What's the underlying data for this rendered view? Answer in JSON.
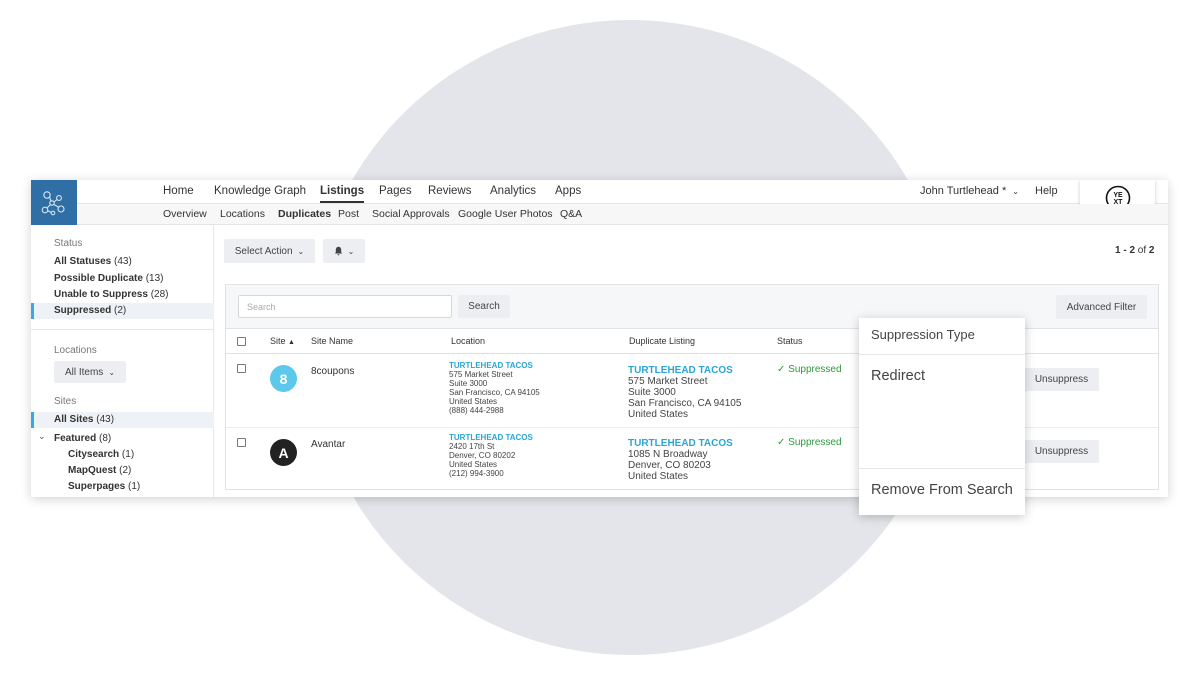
{
  "nav": {
    "primary": [
      "Home",
      "Knowledge Graph",
      "Listings",
      "Pages",
      "Reviews",
      "Analytics",
      "Apps"
    ],
    "secondary": [
      "Overview",
      "Locations",
      "Duplicates",
      "Post",
      "Social Approvals",
      "Google User Photos",
      "Q&A"
    ],
    "user": "John Turtlehead *",
    "help": "Help"
  },
  "sidebar": {
    "status_label": "Status",
    "statuses": [
      {
        "label": "All Statuses",
        "count": "(43)"
      },
      {
        "label": "Possible Duplicate",
        "count": "(13)"
      },
      {
        "label": "Unable to Suppress",
        "count": "(28)"
      },
      {
        "label": "Suppressed",
        "count": "(2)"
      }
    ],
    "locations_label": "Locations",
    "locations_value": "All Items",
    "sites_label": "Sites",
    "sites": [
      {
        "label": "All Sites",
        "count": "(43)"
      },
      {
        "label": "Featured",
        "count": "(8)"
      },
      {
        "label": "Citysearch",
        "count": "(1)"
      },
      {
        "label": "MapQuest",
        "count": "(2)"
      },
      {
        "label": "Superpages",
        "count": "(1)"
      }
    ]
  },
  "toolbar": {
    "select_action": "Select Action",
    "pagination_range": "1 - 2",
    "pagination_of": "of",
    "pagination_total": "2"
  },
  "filter": {
    "search_placeholder": "Search",
    "search_button": "Search",
    "advanced_filter": "Advanced Filter"
  },
  "table": {
    "headers": {
      "site": "Site",
      "site_name": "Site Name",
      "location": "Location",
      "duplicate": "Duplicate Listing",
      "status": "Status"
    },
    "rows": [
      {
        "site_name": "8coupons",
        "avatar_letter": "8",
        "avatar_color": "#5bc8ec",
        "location": [
          "TURTLEHEAD TACOS",
          "575 Market Street",
          "Suite 3000",
          "San Francisco, CA 94105",
          "United States",
          "(888) 444-2988"
        ],
        "duplicate": [
          "TURTLEHEAD TACOS",
          "575 Market Street",
          "Suite 3000",
          "San Francisco, CA 94105",
          "United States"
        ],
        "status": "Suppressed",
        "action": "Unsuppress"
      },
      {
        "site_name": "Avantar",
        "avatar_letter": "A",
        "avatar_color": "#222222",
        "location": [
          "TURTLEHEAD TACOS",
          "2420 17th St",
          "Denver, CO 80202",
          "United States",
          "(212) 994-3900"
        ],
        "duplicate": [
          "TURTLEHEAD TACOS",
          "1085 N Broadway",
          "Denver, CO 80203",
          "United States"
        ],
        "status": "Suppressed",
        "action": "Unsuppress"
      }
    ]
  },
  "popover": {
    "title": "Suppression Type",
    "options": [
      "Redirect",
      "Remove From Search"
    ]
  },
  "colors": {
    "accent": "#3aa8e0",
    "link": "#2aa6d6",
    "success": "#2e9a3a",
    "logo_bg": "#2f6fa5"
  },
  "icons": {
    "logo": "network-nodes-icon",
    "brand": "yext-logo-icon",
    "bell": "bell-icon",
    "check": "check-icon"
  }
}
